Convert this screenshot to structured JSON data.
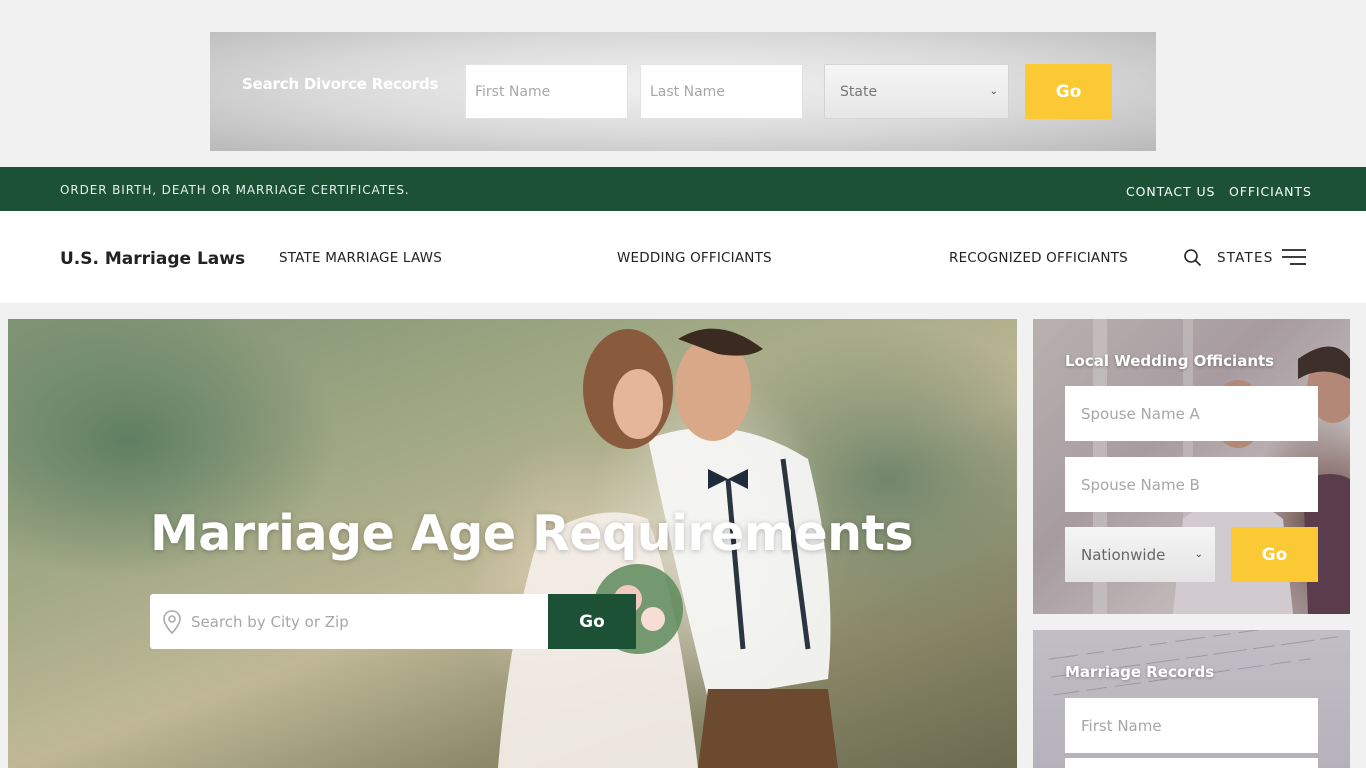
{
  "top_banner": {
    "title": "Search Divorce Records",
    "first_name_placeholder": "First Name",
    "last_name_placeholder": "Last Name",
    "state_value": "State",
    "go_label": "Go"
  },
  "util_bar": {
    "promo": "ORDER BIRTH, DEATH OR MARRIAGE CERTIFICATES.",
    "links": [
      "CONTACT US",
      "OFFICIANTS"
    ]
  },
  "nav": {
    "brand": "U.S. Marriage Laws",
    "items": [
      "STATE MARRIAGE LAWS",
      "WEDDING OFFICIANTS",
      "RECOGNIZED OFFICIANTS"
    ],
    "states_label": "STATES",
    "search_icon": "search-icon",
    "menu_icon": "hamburger-icon"
  },
  "hero": {
    "title": "Marriage Age Requirements",
    "search_placeholder": "Search by City or Zip",
    "go_label": "Go"
  },
  "sidebar": {
    "officiants": {
      "title": "Local Wedding Officiants",
      "spouse_a_placeholder": "Spouse Name A",
      "spouse_b_placeholder": "Spouse Name B",
      "scope_value": "Nationwide",
      "go_label": "Go"
    },
    "records": {
      "title": "Marriage Records",
      "first_name_placeholder": "First Name"
    }
  },
  "colors": {
    "brand_green": "#1c5135",
    "accent_gold": "#fbc933"
  }
}
